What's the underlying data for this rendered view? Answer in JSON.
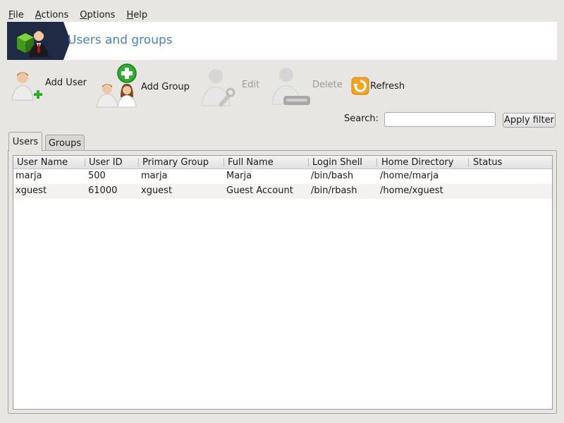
{
  "menu": [
    {
      "mnemonic": "F",
      "rest": "ile"
    },
    {
      "mnemonic": "A",
      "rest": "ctions"
    },
    {
      "mnemonic": "O",
      "rest": "ptions"
    },
    {
      "mnemonic": "H",
      "rest": "elp"
    }
  ],
  "banner": {
    "title": "Users and groups"
  },
  "toolbar": {
    "add_user": "Add User",
    "add_group": "Add Group",
    "edit": "Edit",
    "delete": "Delete",
    "refresh": "Refresh"
  },
  "search": {
    "label": "Search:",
    "value": "",
    "apply_label": "Apply filter"
  },
  "tabs": [
    {
      "label": "Users",
      "active": true
    },
    {
      "label": "Groups",
      "active": false
    }
  ],
  "table": {
    "columns": [
      "User Name",
      "User ID",
      "Primary Group",
      "Full Name",
      "Login Shell",
      "Home Directory",
      "Status"
    ],
    "rows": [
      [
        "marja",
        "500",
        "marja",
        "Marja",
        "/bin/bash",
        "/home/marja",
        ""
      ],
      [
        "xguest",
        "61000",
        "xguest",
        "Guest Account",
        "/bin/rbash",
        "/home/xguest",
        ""
      ]
    ]
  },
  "colors": {
    "banner_bg": "#1f2a44",
    "title_blue": "#4a7fc1",
    "add_green": "#2fae2f",
    "refresh_orange": "#f0a020"
  }
}
